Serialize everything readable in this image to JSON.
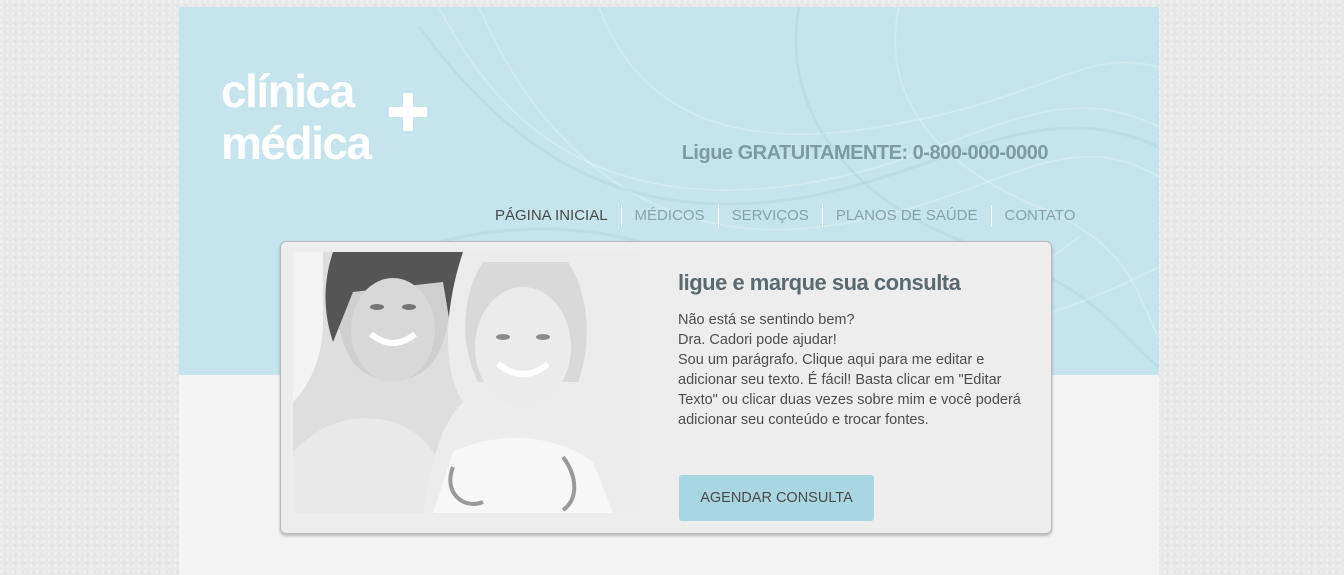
{
  "logo": {
    "line1": "clínica",
    "line2": "médica",
    "icon": "plus-icon"
  },
  "header": {
    "phone": "Ligue GRATUITAMENTE: 0-800-000-0000"
  },
  "nav": {
    "items": [
      {
        "label": "PÁGINA INICIAL",
        "active": true
      },
      {
        "label": "MÉDICOS",
        "active": false
      },
      {
        "label": "SERVIÇOS",
        "active": false
      },
      {
        "label": "PLANOS DE SAÚDE",
        "active": false
      },
      {
        "label": "CONTATO",
        "active": false
      }
    ]
  },
  "card": {
    "title": "ligue e marque sua consulta",
    "lines": [
      "Não está se sentindo bem?",
      "Dra. Cadori pode ajudar!",
      "Sou um parágrafo. Clique aqui para me editar e adicionar seu texto. É fácil! Basta clicar em \"Editar Texto\" ou clicar duas vezes sobre mim e você poderá adicionar seu conteúdo e trocar fontes."
    ],
    "button_label": "AGENDAR CONSULTA"
  },
  "colors": {
    "header_bg": "#c6e4ed",
    "accent_button": "#a8d6e1",
    "phone_text": "#7f9aa4",
    "title_text": "#5a6a70"
  }
}
